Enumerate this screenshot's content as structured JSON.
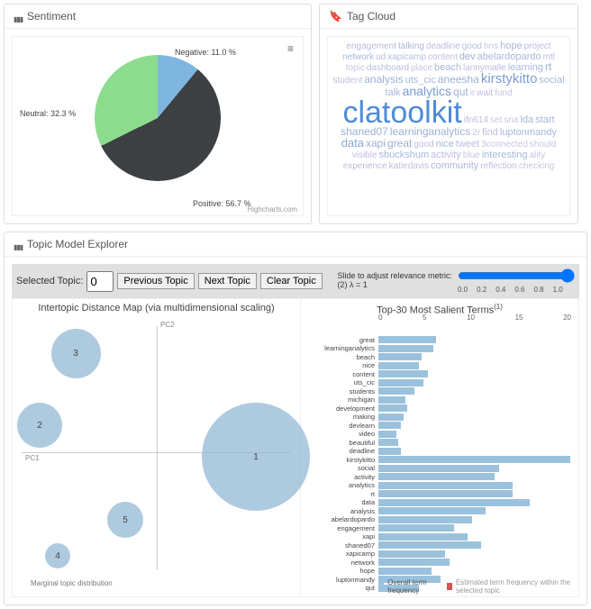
{
  "sentiment": {
    "title": "Sentiment",
    "credit": "Highcharts.com",
    "labels": {
      "negative": "Negative: 11.0 %",
      "neutral": "Neutral: 32.3 %",
      "positive": "Positive: 56.7 %"
    }
  },
  "tagcloud": {
    "title": "Tag Cloud",
    "words": [
      {
        "t": "engagement",
        "s": 10,
        "c": "#b9b9e0"
      },
      {
        "t": "talking",
        "s": 10,
        "c": "#a7b8da"
      },
      {
        "t": "deadline",
        "s": 10,
        "c": "#bcbce2"
      },
      {
        "t": "good",
        "s": 10,
        "c": "#b3c1de"
      },
      {
        "t": "hns",
        "s": 10,
        "c": "#c6c6e6"
      },
      {
        "t": "hope",
        "s": 11,
        "c": "#a7b8da"
      },
      {
        "t": "project",
        "s": 10,
        "c": "#bcbce2"
      },
      {
        "t": "network",
        "s": 10,
        "c": "#a7b8da"
      },
      {
        "t": "ud",
        "s": 10,
        "c": "#bcbce2"
      },
      {
        "t": "xapicamp",
        "s": 10,
        "c": "#b3c1de"
      },
      {
        "t": "content",
        "s": 10,
        "c": "#bcbce2"
      },
      {
        "t": "dev",
        "s": 11,
        "c": "#9dafd6"
      },
      {
        "t": "abelardopardo",
        "s": 11,
        "c": "#a7b8da"
      },
      {
        "t": "mtl",
        "s": 10,
        "c": "#bcbce2"
      },
      {
        "t": "topic",
        "s": 10,
        "c": "#c6c6e6"
      },
      {
        "t": "dashboard",
        "s": 10,
        "c": "#b3c1de"
      },
      {
        "t": "place",
        "s": 10,
        "c": "#c6c6e6"
      },
      {
        "t": "beach",
        "s": 11,
        "c": "#a7b8da"
      },
      {
        "t": "lannymalle",
        "s": 10,
        "c": "#bcbce2"
      },
      {
        "t": "learning",
        "s": 11,
        "c": "#a7b8da"
      },
      {
        "t": "rt",
        "s": 12,
        "c": "#9dafd6"
      },
      {
        "t": "student",
        "s": 10,
        "c": "#bcbce2"
      },
      {
        "t": "analysis",
        "s": 12,
        "c": "#9dafd6"
      },
      {
        "t": "uts_cic",
        "s": 11,
        "c": "#a7b8da"
      },
      {
        "t": "aneesha",
        "s": 12,
        "c": "#9dafd6"
      },
      {
        "t": "kirstykitto",
        "s": 15,
        "c": "#7b9cd0"
      },
      {
        "t": "social",
        "s": 11,
        "c": "#a7b8da"
      },
      {
        "t": "talk",
        "s": 11,
        "c": "#a7b8da"
      },
      {
        "t": "analytics",
        "s": 14,
        "c": "#7b9cd0"
      },
      {
        "t": "qut",
        "s": 12,
        "c": "#9dafd6"
      },
      {
        "t": "ir",
        "s": 10,
        "c": "#c6c6e6"
      },
      {
        "t": "wait",
        "s": 10,
        "c": "#bcbce2"
      },
      {
        "t": "fund",
        "s": 10,
        "c": "#c6c6e6"
      },
      {
        "t": "clatoolkit",
        "s": 34,
        "c": "#4f8bd6"
      },
      {
        "t": "ifn614",
        "s": 10,
        "c": "#bcbce2"
      },
      {
        "t": "set",
        "s": 10,
        "c": "#c6c6e6"
      },
      {
        "t": "sna",
        "s": 10,
        "c": "#c6c6e6"
      },
      {
        "t": "lda",
        "s": 11,
        "c": "#a7b8da"
      },
      {
        "t": "start",
        "s": 11,
        "c": "#a7b8da"
      },
      {
        "t": "shaned07",
        "s": 12,
        "c": "#9dafd6"
      },
      {
        "t": "learninganalytics",
        "s": 12,
        "c": "#9dafd6"
      },
      {
        "t": "2r",
        "s": 10,
        "c": "#c6c6e6"
      },
      {
        "t": "find",
        "s": 11,
        "c": "#bcbce2"
      },
      {
        "t": "luptonmandy",
        "s": 11,
        "c": "#a7b8da"
      },
      {
        "t": "data",
        "s": 13,
        "c": "#8aa7d4"
      },
      {
        "t": "xapi",
        "s": 12,
        "c": "#9dafd6"
      },
      {
        "t": "great",
        "s": 12,
        "c": "#9dafd6"
      },
      {
        "t": "good",
        "s": 10,
        "c": "#bcbce2"
      },
      {
        "t": "nice",
        "s": 11,
        "c": "#a7b8da"
      },
      {
        "t": "tweet",
        "s": 11,
        "c": "#bcbce2"
      },
      {
        "t": "3connected",
        "s": 10,
        "c": "#c6c6e6"
      },
      {
        "t": "should",
        "s": 10,
        "c": "#c6c6e6"
      },
      {
        "t": "visible",
        "s": 10,
        "c": "#bcbce2"
      },
      {
        "t": "sbuckshum",
        "s": 11,
        "c": "#a7b8da"
      },
      {
        "t": "activity",
        "s": 11,
        "c": "#bcbce2"
      },
      {
        "t": "blue",
        "s": 10,
        "c": "#c6c6e6"
      },
      {
        "t": "interesting",
        "s": 11,
        "c": "#a7b8da"
      },
      {
        "t": "ality",
        "s": 10,
        "c": "#c6c6e6"
      },
      {
        "t": "experience",
        "s": 10,
        "c": "#bcbce2"
      },
      {
        "t": "katiedavis",
        "s": 10,
        "c": "#bcbce2"
      },
      {
        "t": "community",
        "s": 11,
        "c": "#a7b8da"
      },
      {
        "t": "reflection",
        "s": 10,
        "c": "#bcbce2"
      },
      {
        "t": "checking",
        "s": 10,
        "c": "#c6c6e6"
      }
    ]
  },
  "topic_explorer": {
    "title": "Topic Model Explorer",
    "selected_label": "Selected Topic:",
    "selected_value": "0",
    "prev": "Previous Topic",
    "next": "Next Topic",
    "clear": "Clear Topic",
    "slider_label": "Slide to adjust relevance metric:",
    "slider_sub": "(2)",
    "slider_eq": "λ = 1",
    "slider_ticks": [
      "0.0",
      "0.2",
      "0.4",
      "0.6",
      "0.8",
      "1.0"
    ],
    "mds_title": "Intertopic Distance Map (via multidimensional scaling)",
    "terms_title": "Top-30 Most Salient Terms",
    "terms_sup": "(1)",
    "pc1": "PC1",
    "pc2": "PC2",
    "marginal": "Marginal topic distribution",
    "bar_ticks": [
      "0",
      "5",
      "10",
      "15",
      "20"
    ],
    "legend1": "Overall term frequency",
    "legend2": "Estimated term frequency within the selected topic"
  },
  "chart_data": [
    {
      "type": "pie",
      "title": "Sentiment",
      "series": [
        {
          "name": "Negative",
          "value": 11.0,
          "color": "#7fb6e0"
        },
        {
          "name": "Neutral",
          "value": 32.3,
          "color": "#8cdc8e"
        },
        {
          "name": "Positive",
          "value": 56.7,
          "color": "#3c4043"
        }
      ]
    },
    {
      "type": "scatter",
      "title": "Intertopic Distance Map (via multidimensional scaling)",
      "xlabel": "PC1",
      "ylabel": "PC2",
      "points": [
        {
          "id": "1",
          "x": 1.1,
          "y": -0.05,
          "size": 120
        },
        {
          "id": "2",
          "x": -1.3,
          "y": 0.3,
          "size": 50
        },
        {
          "id": "3",
          "x": -0.9,
          "y": 1.1,
          "size": 55
        },
        {
          "id": "4",
          "x": -1.1,
          "y": -1.15,
          "size": 28
        },
        {
          "id": "5",
          "x": -0.35,
          "y": -0.75,
          "size": 40
        }
      ]
    },
    {
      "type": "bar",
      "title": "Top-30 Most Salient Terms",
      "xlabel": "",
      "ylabel": "",
      "xlim": [
        0,
        22
      ],
      "categories": [
        "great",
        "learninganalytics",
        "beach",
        "nice",
        "content",
        "uts_cic",
        "students",
        "michigan",
        "development",
        "making",
        "devlearn",
        "video",
        "beautiful",
        "deadline",
        "kirstykitto",
        "social",
        "activity",
        "analytics",
        "rt",
        "data",
        "analysis",
        "abelardopardo",
        "engagement",
        "xapi",
        "shaned07",
        "xapicamp",
        "network",
        "hope",
        "luptonmandy",
        "qut"
      ],
      "values": [
        6.5,
        6.2,
        4.8,
        4.5,
        5.5,
        5.0,
        4.0,
        3.0,
        3.2,
        2.8,
        2.5,
        2.0,
        2.2,
        2.5,
        21.5,
        13.5,
        13.0,
        15.0,
        15.0,
        17.0,
        12.0,
        10.5,
        8.5,
        10.0,
        11.5,
        7.5,
        8.0,
        6.0,
        7.0,
        4.5
      ]
    }
  ]
}
